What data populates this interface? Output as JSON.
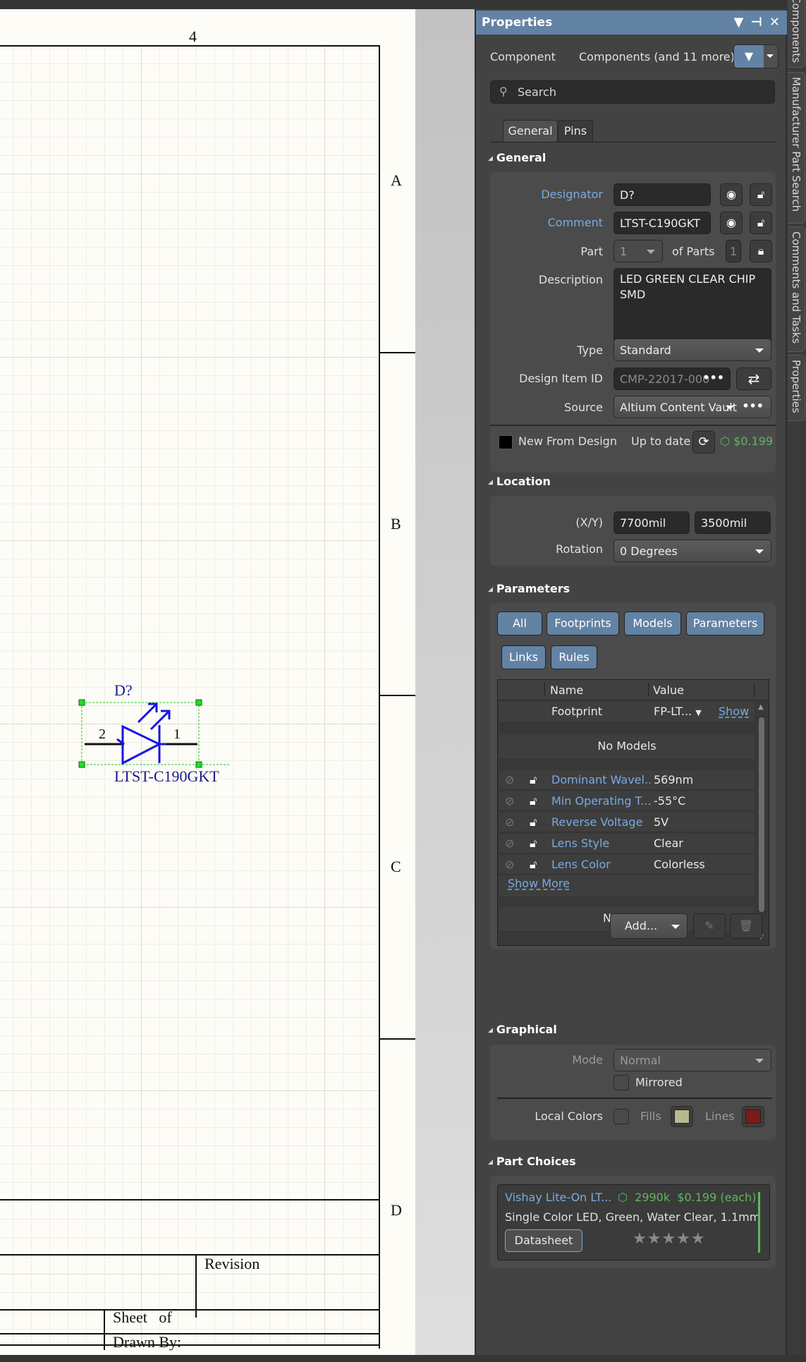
{
  "schematic": {
    "column_number": "4",
    "zones": [
      "A",
      "B",
      "C",
      "D"
    ],
    "title_block": {
      "revision": "Revision",
      "sheet": "Sheet",
      "of": "of",
      "drawn_by": "Drawn By:"
    },
    "component": {
      "designator": "D?",
      "comment": "LTST-C190GKT",
      "pin_left": "2",
      "pin_right": "1"
    }
  },
  "side_tabs": [
    "Components",
    "Manufacturer Part Search",
    "Comments and Tasks",
    "Properties"
  ],
  "panel": {
    "title": "Properties",
    "title_icons": [
      "menu-icon",
      "pin-icon",
      "close-icon"
    ],
    "selection_kind": "Component",
    "selection_filter": "Components (and 11 more)",
    "search_placeholder": "Search",
    "tabs": [
      "General",
      "Pins"
    ],
    "general": {
      "heading": "General",
      "designator_label": "Designator",
      "designator_value": "D?",
      "comment_label": "Comment",
      "comment_value": "LTST-C190GKT",
      "part_label": "Part",
      "part_value": "1",
      "of_parts_label": "of Parts",
      "of_parts_value": "1",
      "description_label": "Description",
      "description_value": "LED GREEN CLEAR CHIP SMD",
      "type_label": "Type",
      "type_value": "Standard",
      "design_item_label": "Design Item ID",
      "design_item_value": "CMP-22017-000",
      "source_label": "Source",
      "source_value": "Altium Content Vault",
      "new_from_design": "New From Design",
      "status": "Up to date",
      "price": "$0.199 (",
      "new_from_design_color": "#000000"
    },
    "location": {
      "heading": "Location",
      "xy_label": "(X/Y)",
      "x_value": "7700mil",
      "y_value": "3500mil",
      "rotation_label": "Rotation",
      "rotation_value": "0 Degrees"
    },
    "parameters": {
      "heading": "Parameters",
      "filters": [
        "All",
        "Footprints",
        "Models",
        "Parameters",
        "Links",
        "Rules"
      ],
      "columns": [
        "Name",
        "Value"
      ],
      "footprint": {
        "name": "Footprint",
        "value": "FP-LT...",
        "action": "Show"
      },
      "no_models": "No Models",
      "rows": [
        {
          "name": "Dominant Wavel...",
          "value": "569nm"
        },
        {
          "name": "Min Operating T...",
          "value": "-55°C"
        },
        {
          "name": "Reverse Voltage",
          "value": "5V"
        },
        {
          "name": "Lens Style",
          "value": "Clear"
        },
        {
          "name": "Lens Color",
          "value": "Colorless"
        }
      ],
      "show_more": "Show More",
      "no_links": "No Links",
      "add_label": "Add..."
    },
    "graphical": {
      "heading": "Graphical",
      "mode_label": "Mode",
      "mode_value": "Normal",
      "mirrored_label": "Mirrored",
      "local_colors_label": "Local Colors",
      "fills_label": "Fills",
      "lines_label": "Lines",
      "fills_color": "#b8b88e",
      "lines_color": "#7a1a1a"
    },
    "part_choices": {
      "heading": "Part Choices",
      "supplier": "Vishay Lite-On LT...",
      "stock": "2990k",
      "price": "$0.199 (each)",
      "description": "Single Color LED, Green, Water Clear, 1.1mm",
      "datasheet_label": "Datasheet",
      "rating": "0 of 5",
      "stars": "★★★★★"
    }
  }
}
